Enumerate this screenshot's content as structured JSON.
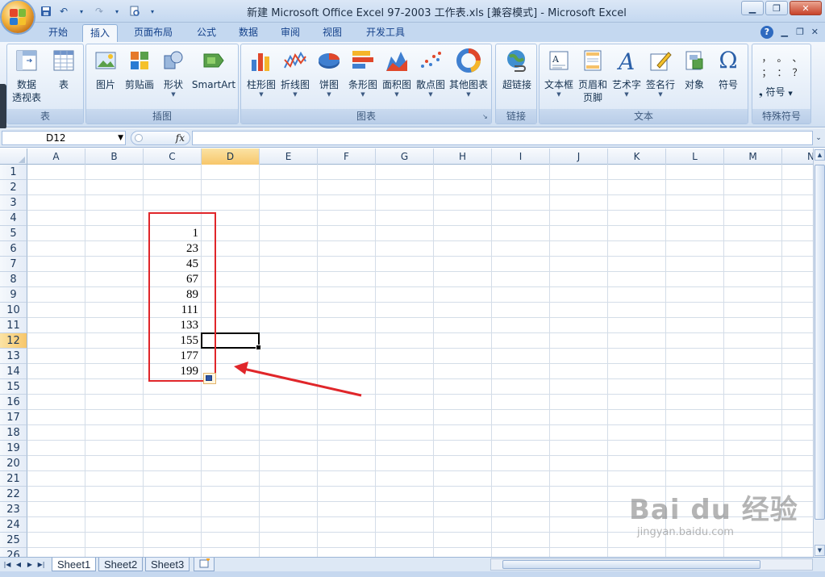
{
  "window": {
    "title": "新建 Microsoft Office Excel 97-2003 工作表.xls  [兼容模式] - Microsoft Excel"
  },
  "ribbon_tabs": [
    "开始",
    "插入",
    "页面布局",
    "公式",
    "数据",
    "审阅",
    "视图",
    "开发工具"
  ],
  "active_tab": "插入",
  "groups": {
    "table": {
      "name": "表",
      "btn1_line1": "数据",
      "btn1_line2": "透视表",
      "btn2": "表"
    },
    "illustrations": {
      "name": "插图",
      "picture": "图片",
      "clipart": "剪贴画",
      "shapes": "形状",
      "smartart": "SmartArt"
    },
    "charts": {
      "name": "图表",
      "column": "柱形图",
      "line": "折线图",
      "pie": "饼图",
      "bar": "条形图",
      "area": "面积图",
      "scatter": "散点图",
      "other": "其他图表"
    },
    "links": {
      "name": "链接",
      "hyperlink": "超链接"
    },
    "text": {
      "name": "文本",
      "textbox": "文本框",
      "header_line1": "页眉和",
      "header_line2": "页脚",
      "wordart": "艺术字",
      "signature": "签名行",
      "object": "对象",
      "symbol": "符号"
    },
    "special": {
      "name": "特殊符号",
      "symbol_btn": "符号",
      "symbols": [
        "，",
        "。",
        "、",
        "；",
        "：",
        "？"
      ]
    }
  },
  "formula_bar": {
    "namebox": "D12",
    "fx": "fx",
    "content": ""
  },
  "columns": [
    "A",
    "B",
    "C",
    "D",
    "E",
    "F",
    "G",
    "H",
    "I",
    "J",
    "K",
    "L",
    "M",
    "N"
  ],
  "selected_column": "D",
  "rows": [
    "1",
    "2",
    "3",
    "4",
    "5",
    "6",
    "7",
    "8",
    "9",
    "10",
    "11",
    "12",
    "13",
    "14",
    "15",
    "16",
    "17",
    "18",
    "19",
    "20",
    "21",
    "22",
    "23",
    "24",
    "25",
    "26"
  ],
  "selected_row": "12",
  "cell_values": [
    {
      "ref": "C5",
      "value": "1"
    },
    {
      "ref": "C6",
      "value": "23"
    },
    {
      "ref": "C7",
      "value": "45"
    },
    {
      "ref": "C8",
      "value": "67"
    },
    {
      "ref": "C9",
      "value": "89"
    },
    {
      "ref": "C10",
      "value": "111"
    },
    {
      "ref": "C11",
      "value": "133"
    },
    {
      "ref": "C12",
      "value": "155"
    },
    {
      "ref": "C13",
      "value": "177"
    },
    {
      "ref": "C14",
      "value": "199"
    }
  ],
  "sheets": [
    "Sheet1",
    "Sheet2",
    "Sheet3"
  ],
  "active_sheet": "Sheet1",
  "watermark": {
    "big": "Bai du 经验",
    "small": "jingyan.baidu.com"
  },
  "colors": {
    "annotation_red": "#e0262a",
    "header_select": "#f7c66a",
    "ribbon_bg": "#dde8f6"
  }
}
